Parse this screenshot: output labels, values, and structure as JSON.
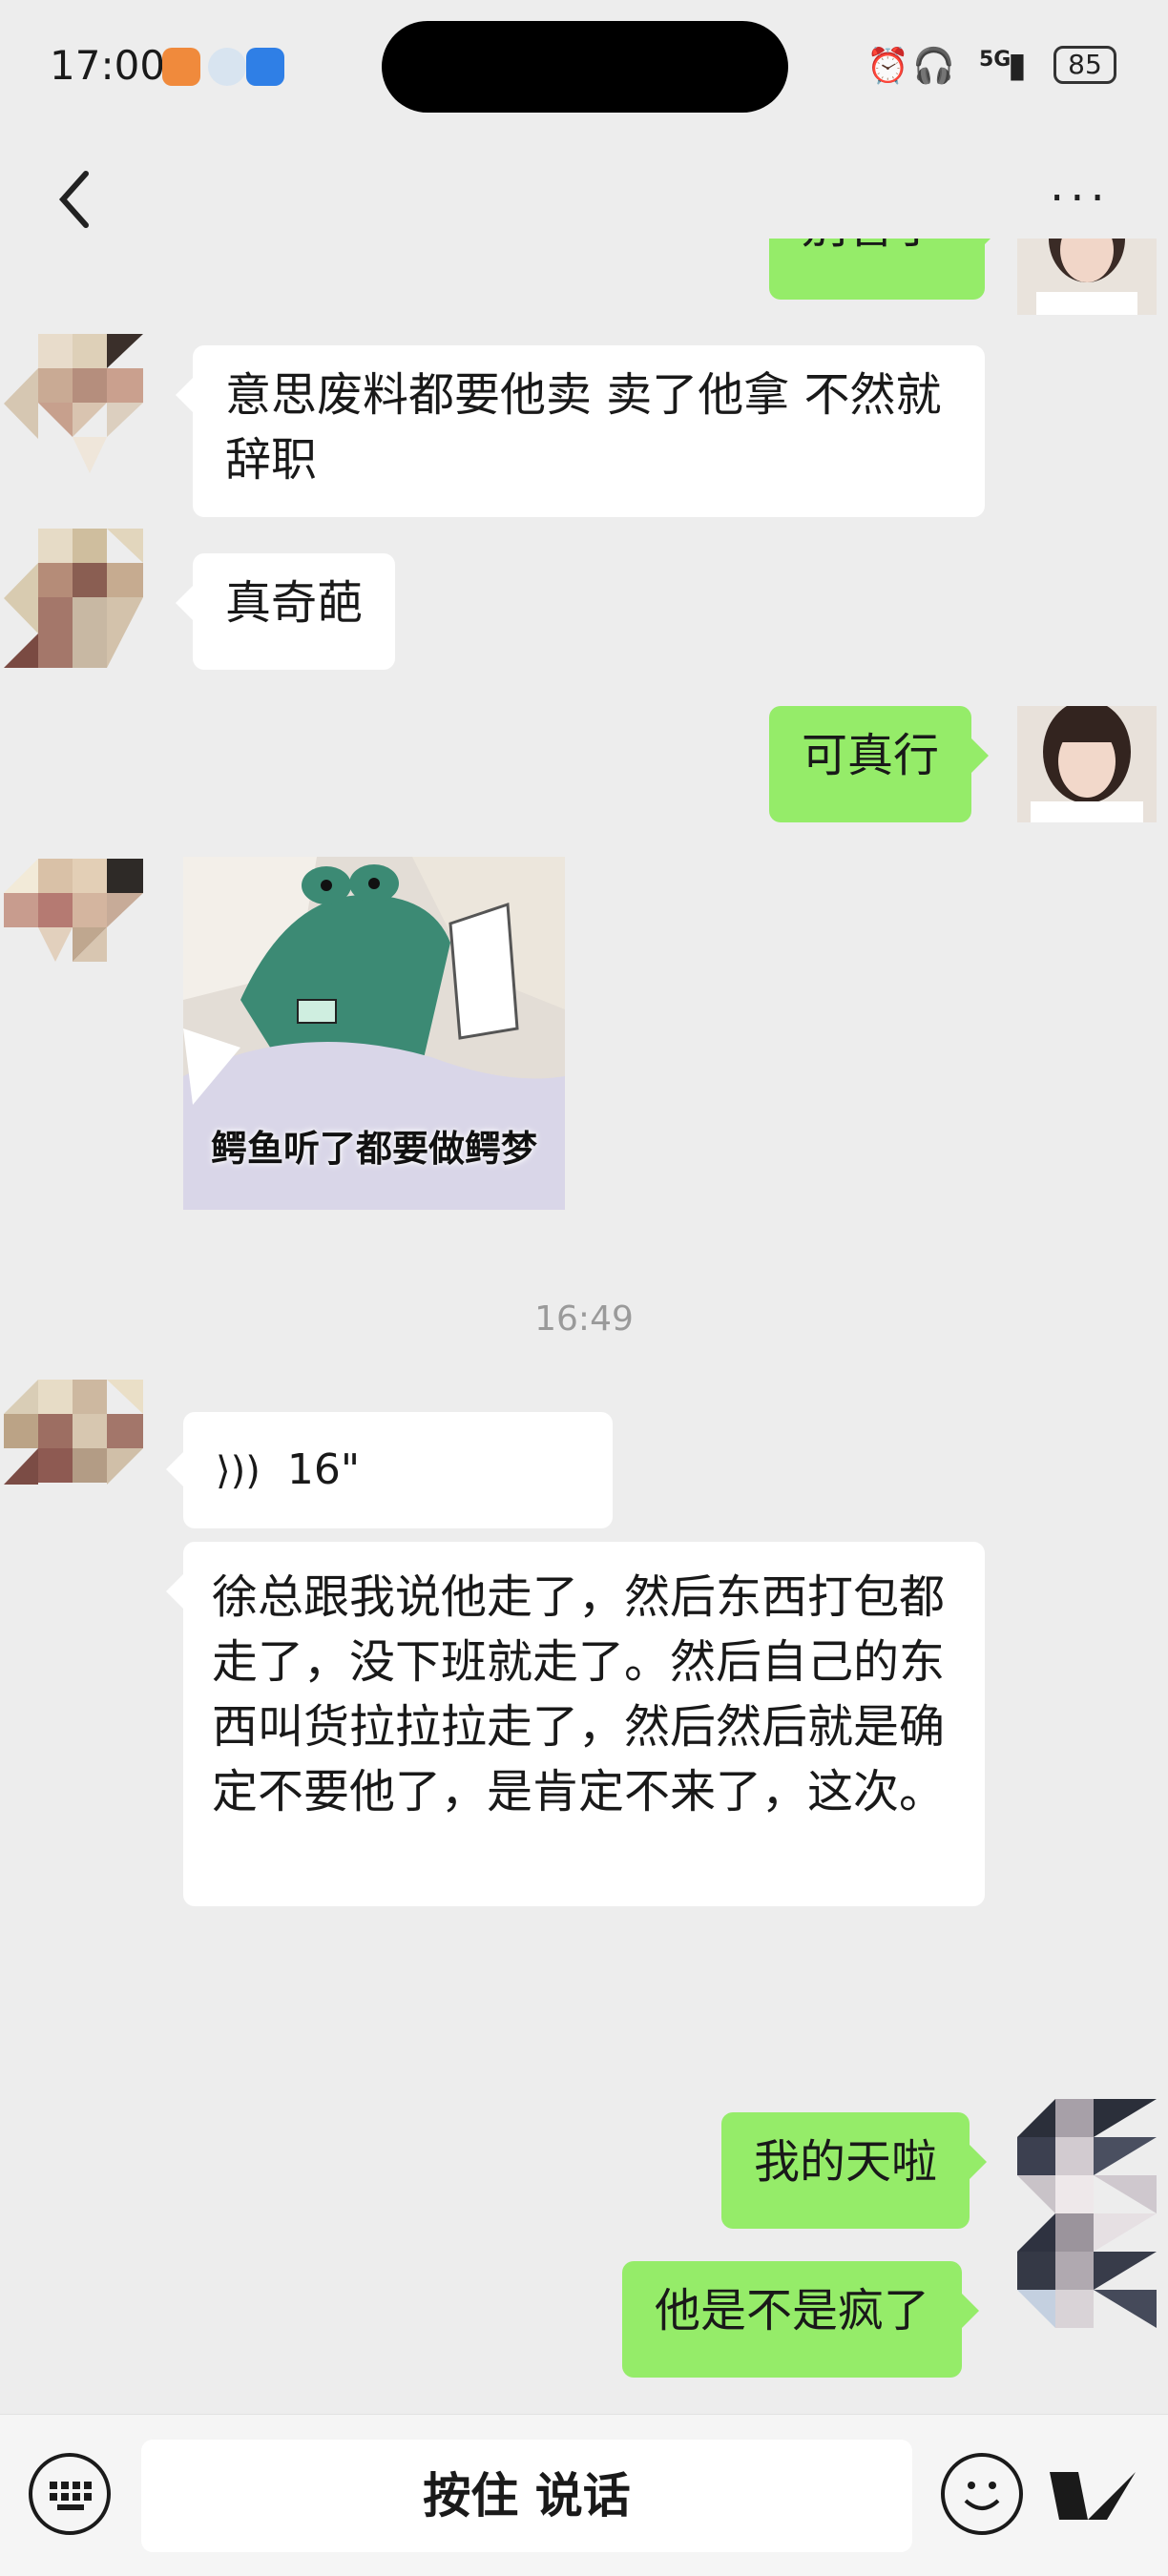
{
  "status_bar": {
    "time": "17:00",
    "network": "5G",
    "battery": "85"
  },
  "nav": {
    "back_icon": "chevron-left-icon",
    "more_label": "···"
  },
  "messages": [
    {
      "side": "right",
      "text": "别管了"
    },
    {
      "side": "left",
      "text": "意思废料都要他卖  卖了他拿 不然就辞职"
    },
    {
      "side": "left",
      "text": "真奇葩"
    },
    {
      "side": "right",
      "text": "可真行"
    },
    {
      "side": "left",
      "type": "sticker",
      "caption": "鳄鱼听了都要做鳄梦"
    },
    {
      "type": "time",
      "text": "16:49"
    },
    {
      "side": "left",
      "type": "voice",
      "duration": "16\""
    },
    {
      "side": "left",
      "text": "徐总跟我说他走了，然后东西打包都走了，没下班就走了。然后自己的东西叫货拉拉拉走了，然后然后就是确定不要他了，是肯定不来了，这次。"
    },
    {
      "side": "right",
      "text": "我的天啦"
    },
    {
      "side": "right",
      "text": "他是不是疯了"
    }
  ],
  "input_bar": {
    "hold_to_talk": "按住 说话",
    "keyboard_icon": "keyboard-icon",
    "emoji_icon": "emoji-icon",
    "plus_icon": "plus-icon"
  },
  "colors": {
    "background": "#ededed",
    "bubble_self": "#95ec69",
    "bubble_other": "#ffffff"
  }
}
